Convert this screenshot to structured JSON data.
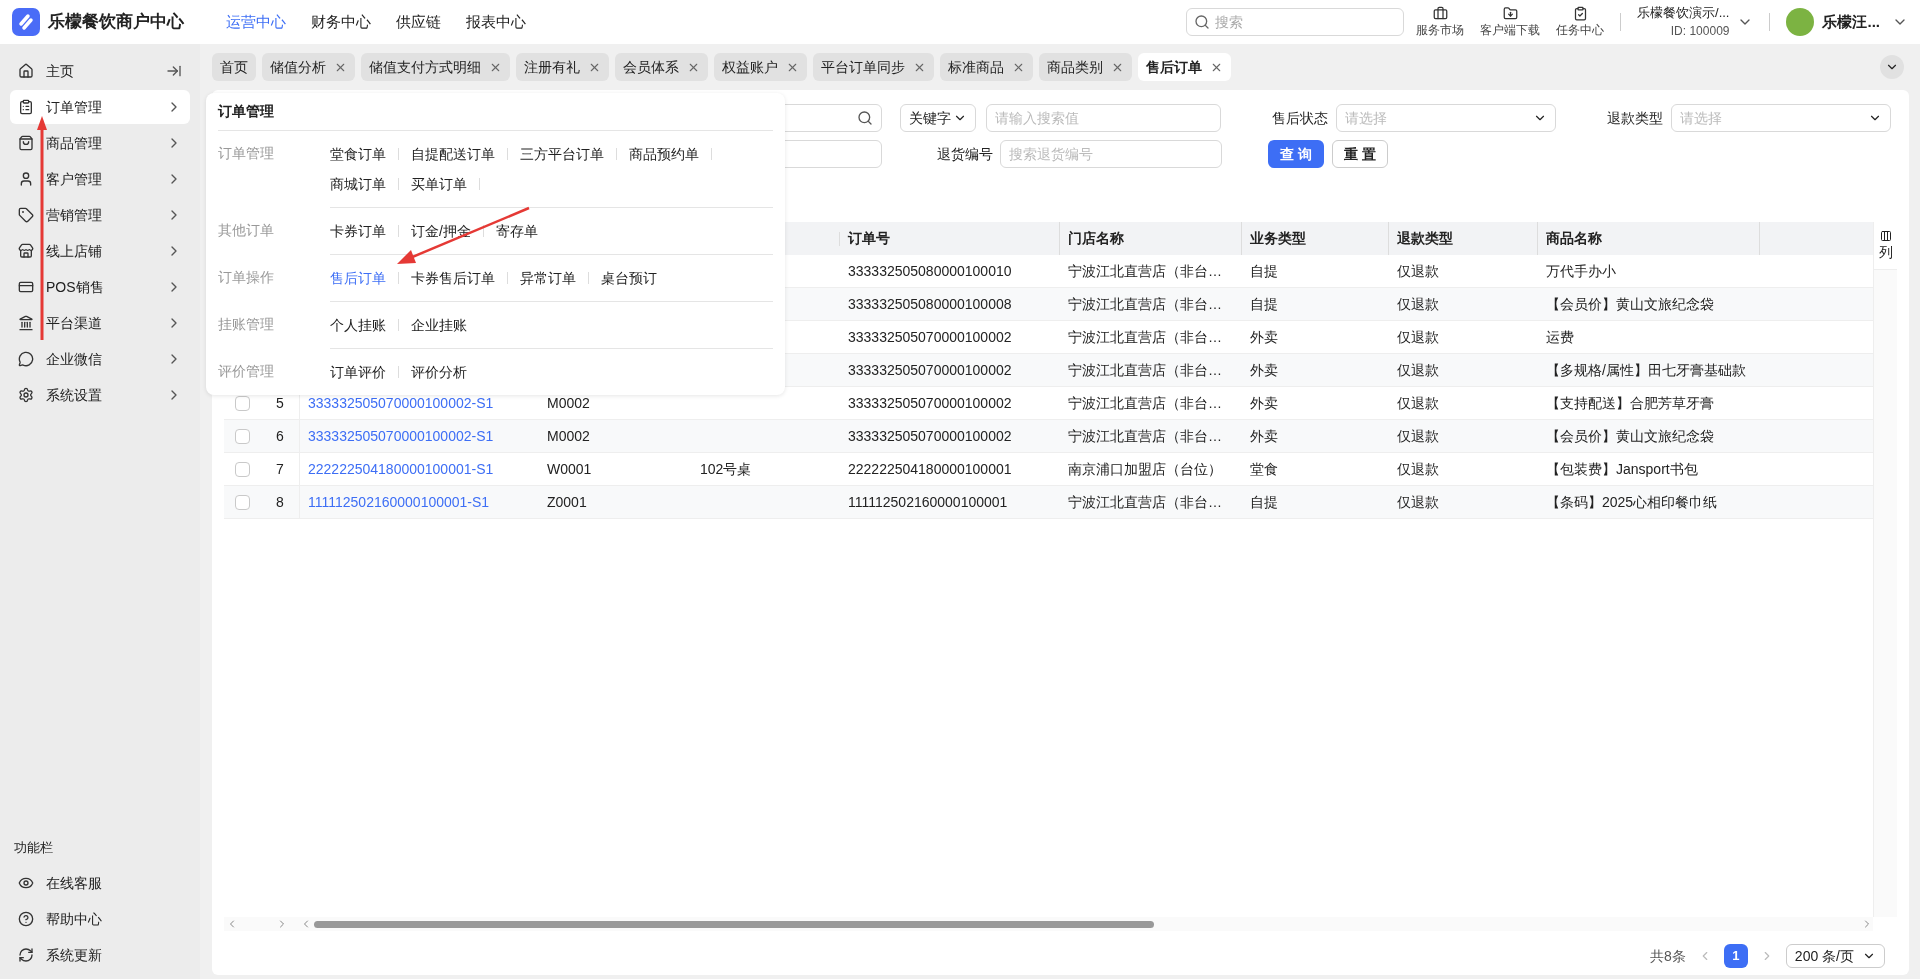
{
  "header": {
    "logo_text": "乐檬餐饮商户中心",
    "nav": [
      {
        "label": "运营中心",
        "selected": true
      },
      {
        "label": "财务中心",
        "selected": false
      },
      {
        "label": "供应链",
        "selected": false
      },
      {
        "label": "报表中心",
        "selected": false
      }
    ],
    "search": {
      "placeholder": "搜索"
    },
    "tools": [
      {
        "label": "服务市场"
      },
      {
        "label": "客户端下载"
      },
      {
        "label": "任务中心"
      }
    ],
    "account": {
      "name": "乐檬餐饮演示/...",
      "id": "ID: 100009"
    },
    "user": {
      "name": "乐檬汪..."
    }
  },
  "sidebar": {
    "home": {
      "label": "主页"
    },
    "items": [
      {
        "label": "订单管理",
        "selected": true
      },
      {
        "label": "商品管理",
        "selected": false
      },
      {
        "label": "客户管理",
        "selected": false
      },
      {
        "label": "营销管理",
        "selected": false
      },
      {
        "label": "线上店铺",
        "selected": false
      },
      {
        "label": "POS销售",
        "selected": false
      },
      {
        "label": "平台渠道",
        "selected": false
      },
      {
        "label": "企业微信",
        "selected": false
      },
      {
        "label": "系统设置",
        "selected": false
      }
    ],
    "footer_title": "功能栏",
    "footer_items": [
      "在线客服",
      "帮助中心",
      "系统更新"
    ]
  },
  "tabs": [
    {
      "label": "首页",
      "selected": false,
      "closable": false
    },
    {
      "label": "储值分析",
      "selected": false,
      "closable": true
    },
    {
      "label": "储值支付方式明细",
      "selected": false,
      "closable": true
    },
    {
      "label": "注册有礼",
      "selected": false,
      "closable": true
    },
    {
      "label": "会员体系",
      "selected": false,
      "closable": true
    },
    {
      "label": "权益账户",
      "selected": false,
      "closable": true
    },
    {
      "label": "平台订单同步",
      "selected": false,
      "closable": true
    },
    {
      "label": "标准商品",
      "selected": false,
      "closable": true
    },
    {
      "label": "商品类别",
      "selected": false,
      "closable": true
    },
    {
      "label": "售后订单",
      "selected": true,
      "closable": true
    }
  ],
  "filters": {
    "keyword_type": "关键字",
    "keyword_placeholder": "请输入搜索值",
    "status_label": "售后状态",
    "status_placeholder": "请选择",
    "refund_type_label": "退款类型",
    "refund_type_placeholder": "请选择",
    "return_no_label": "退货编号",
    "return_no_placeholder": "搜索退货编号",
    "buttons": [
      "查 询",
      "重 置"
    ]
  },
  "table": {
    "columns": [
      "订单号",
      "门店名称",
      "业务类型",
      "退款类型",
      "商品名称"
    ],
    "column_setting": "列",
    "rows": [
      {
        "order_no": "333332505080000100010",
        "store": "宁波江北直营店（非台…",
        "business": "自提",
        "refund": "仅退款",
        "product": "万代手办小"
      },
      {
        "order_no": "333332505080000100008",
        "store": "宁波江北直营店（非台…",
        "business": "自提",
        "refund": "仅退款",
        "product": "【会员价】黄山文旅纪念袋"
      },
      {
        "order_no": "333332505070000100002",
        "store": "宁波江北直营店（非台…",
        "business": "外卖",
        "refund": "仅退款",
        "product": "运费"
      },
      {
        "order_no": "333332505070000100002",
        "store": "宁波江北直营店（非台…",
        "business": "外卖",
        "refund": "仅退款",
        "product": "【多规格/属性】田七牙膏基础款"
      },
      {
        "checked": false,
        "index": "5",
        "after_sale_no": "333332505070000100002-S1",
        "code": "M0002",
        "order_no": "333332505070000100002",
        "store": "宁波江北直营店（非台…",
        "business": "外卖",
        "refund": "仅退款",
        "product": "【支持配送】合肥芳草牙膏"
      },
      {
        "checked": false,
        "index": "6",
        "after_sale_no": "333332505070000100002-S1",
        "code": "M0002",
        "order_no": "333332505070000100002",
        "store": "宁波江北直营店（非台…",
        "business": "外卖",
        "refund": "仅退款",
        "product": "【会员价】黄山文旅纪念袋"
      },
      {
        "checked": false,
        "index": "7",
        "after_sale_no": "222222504180000100001-S1",
        "code": "W0001",
        "table_no": "102号桌",
        "order_no": "222222504180000100001",
        "store": "南京浦口加盟店（台位）",
        "business": "堂食",
        "refund": "仅退款",
        "product": "【包装费】Jansport书包"
      },
      {
        "checked": false,
        "index": "8",
        "after_sale_no": "111112502160000100001-S1",
        "code": "Z0001",
        "order_no": "111112502160000100001",
        "store": "宁波江北直营店（非台…",
        "business": "自提",
        "refund": "仅退款",
        "product": "【条码】2025心相印餐巾纸"
      }
    ]
  },
  "pagination": {
    "total": "共8条",
    "pages": [
      {
        "label": "1",
        "selected": true
      }
    ],
    "page_size": "200 条/页"
  },
  "menu": {
    "title": "订单管理",
    "groups": [
      {
        "label": "订单管理",
        "items": [
          {
            "label": "堂食订单",
            "selected": false
          },
          {
            "label": "自提配送订单",
            "selected": false
          },
          {
            "label": "三方平台订单",
            "selected": false
          },
          {
            "label": "商品预约单",
            "selected": false
          },
          {
            "label": "商城订单",
            "selected": false
          },
          {
            "label": "买单订单",
            "selected": false
          }
        ]
      },
      {
        "label": "其他订单",
        "items": [
          {
            "label": "卡券订单",
            "selected": false
          },
          {
            "label": "订金/押金",
            "selected": false
          },
          {
            "label": "寄存单",
            "selected": false
          }
        ]
      },
      {
        "label": "订单操作",
        "items": [
          {
            "label": "售后订单",
            "selected": true
          },
          {
            "label": "卡券售后订单",
            "selected": false
          },
          {
            "label": "异常订单",
            "selected": false
          },
          {
            "label": "桌台预订",
            "selected": false
          }
        ]
      },
      {
        "label": "挂账管理",
        "items": [
          {
            "label": "个人挂账",
            "selected": false
          },
          {
            "label": "企业挂账",
            "selected": false
          }
        ]
      },
      {
        "label": "评价管理",
        "items": [
          {
            "label": "订单评价",
            "selected": false
          },
          {
            "label": "评价分析",
            "selected": false
          }
        ]
      }
    ]
  }
}
